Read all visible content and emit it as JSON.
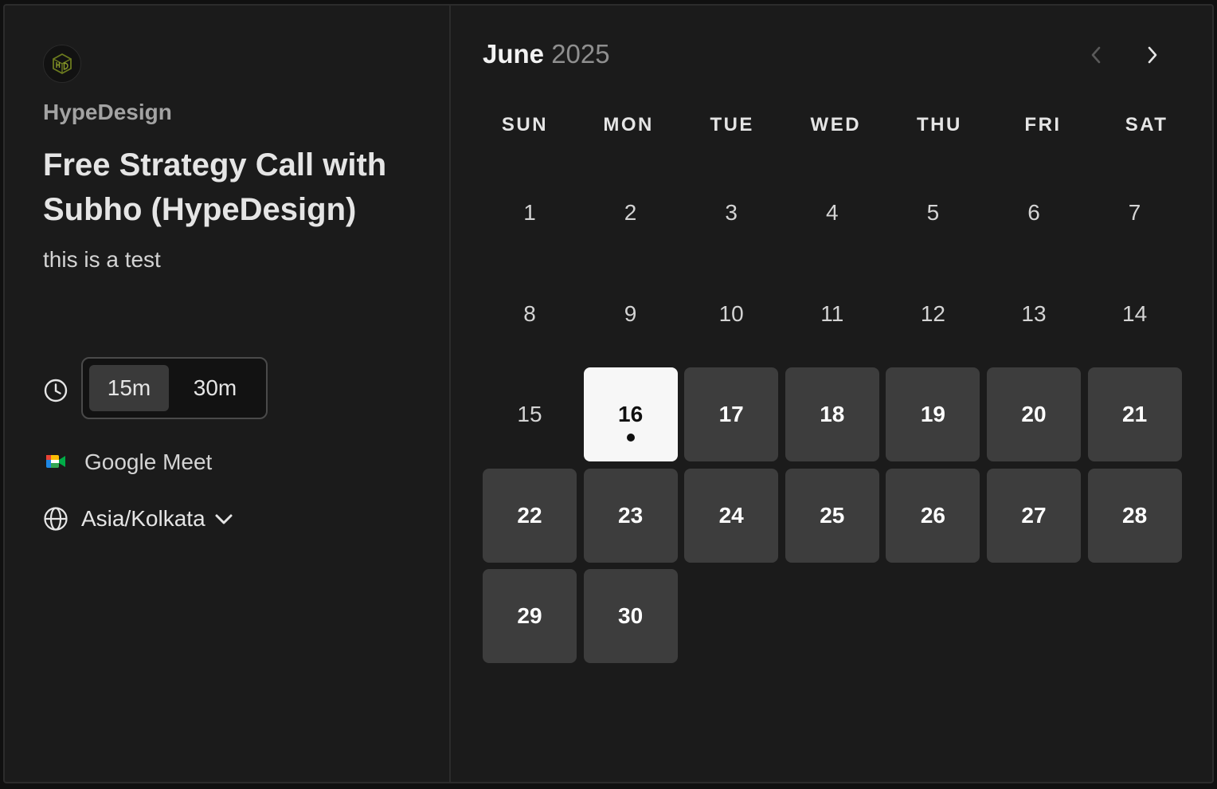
{
  "profile": {
    "org_name": "HypeDesign",
    "event_title": "Free Strategy Call with Subho (HypeDesign)",
    "description": "this is a test",
    "logo_icon": "hd-cube-logo-icon"
  },
  "duration": {
    "options": [
      "15m",
      "30m"
    ],
    "selected": "15m"
  },
  "location": {
    "label": "Google Meet",
    "icon": "google-meet-icon"
  },
  "timezone": {
    "value": "Asia/Kolkata"
  },
  "calendar": {
    "month": "June",
    "year": "2025",
    "weekdays": [
      "SUN",
      "MON",
      "TUE",
      "WED",
      "THU",
      "FRI",
      "SAT"
    ],
    "days": [
      "1",
      "2",
      "3",
      "4",
      "5",
      "6",
      "7",
      "8",
      "9",
      "10",
      "11",
      "12",
      "13",
      "14",
      "15",
      "16",
      "17",
      "18",
      "19",
      "20",
      "21",
      "22",
      "23",
      "24",
      "25",
      "26",
      "27",
      "28",
      "29",
      "30"
    ],
    "first_weekday": 0,
    "selected_day": "16",
    "today_marker_day": "16",
    "available_days": [
      "16",
      "17",
      "18",
      "19",
      "20",
      "21",
      "22",
      "23",
      "24",
      "25",
      "26",
      "27",
      "28",
      "29",
      "30"
    ]
  },
  "colors": {
    "background": "#1b1b1b",
    "available_day": "#3d3d3d",
    "selected_day": "#f7f7f7",
    "muted_text": "#a3a3a3"
  }
}
